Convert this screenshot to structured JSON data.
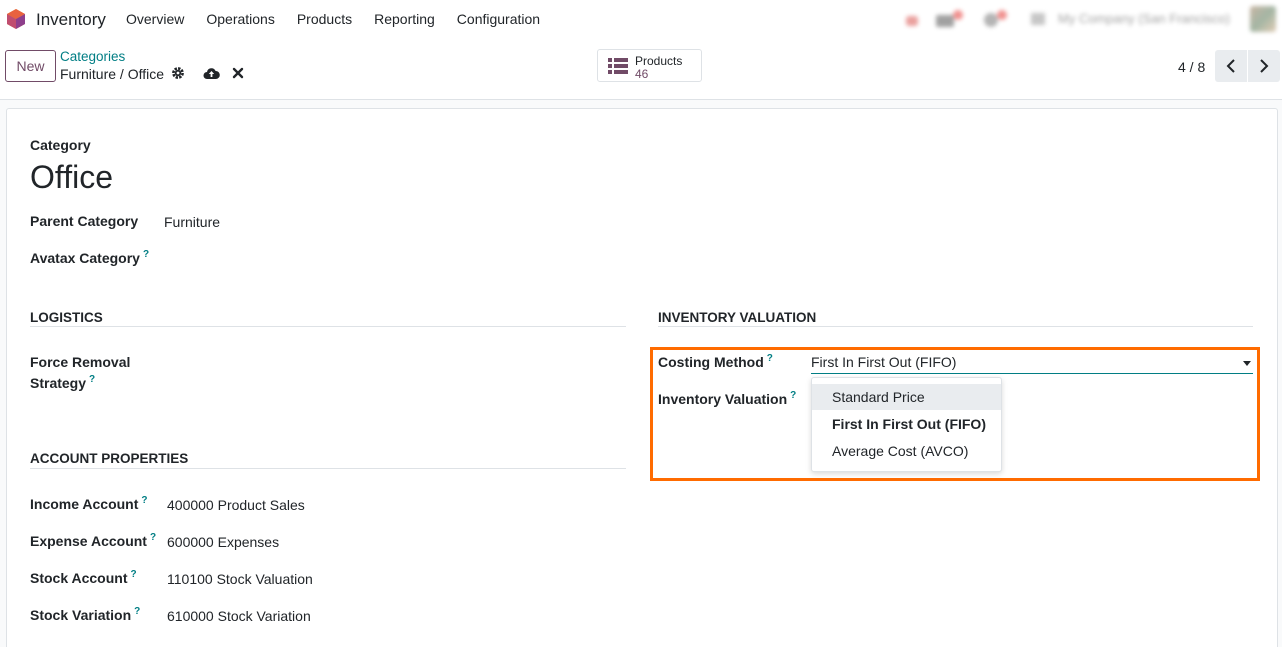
{
  "navbar": {
    "app_name": "Inventory",
    "menu": [
      "Overview",
      "Operations",
      "Products",
      "Reporting",
      "Configuration"
    ],
    "company": "My Company (San Francisco)"
  },
  "control": {
    "new_label": "New",
    "breadcrumb_parent": "Categories",
    "breadcrumb_current": "Furniture / Office",
    "smart_button": {
      "label": "Products",
      "value": "46"
    },
    "pager": "4 / 8"
  },
  "form": {
    "category_label": "Category",
    "name": "Office",
    "parent_category_label": "Parent Category",
    "parent_category_value": "Furniture",
    "avatax_label": "Avatax Category",
    "help_mark": "?",
    "logistics": {
      "title": "LOGISTICS",
      "force_removal_label_1": "Force Removal",
      "force_removal_label_2": "Strategy"
    },
    "account_properties": {
      "title": "ACCOUNT PROPERTIES",
      "rows": [
        {
          "label": "Income Account",
          "value": "400000 Product Sales"
        },
        {
          "label": "Expense Account",
          "value": "600000 Expenses"
        },
        {
          "label": "Stock Account",
          "value": "110100 Stock Valuation"
        },
        {
          "label": "Stock Variation",
          "value": "610000 Stock Variation"
        }
      ]
    },
    "inventory_valuation": {
      "title": "INVENTORY VALUATION",
      "costing_method_label": "Costing Method",
      "costing_method_value": "First In First Out (FIFO)",
      "inventory_valuation_label": "Inventory Valuation",
      "options": [
        "Standard Price",
        "First In First Out (FIFO)",
        "Average Cost (AVCO)"
      ],
      "highlighted_option": "Standard Price",
      "selected_option": "First In First Out (FIFO)"
    }
  },
  "colors": {
    "brand": "#714b67",
    "link": "#017e84",
    "highlight_border": "#ff6b00"
  }
}
